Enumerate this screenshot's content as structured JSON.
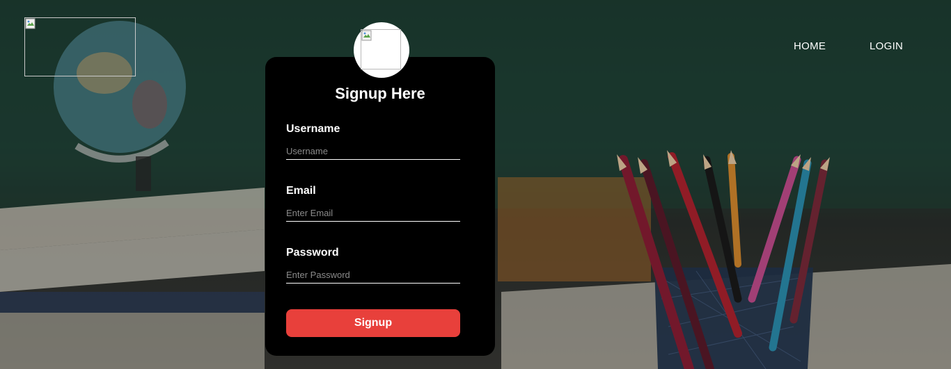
{
  "nav": {
    "home_label": "HOME",
    "login_label": "LOGIN"
  },
  "form": {
    "title": "Signup Here",
    "username": {
      "label": "Username",
      "placeholder": "Username",
      "value": ""
    },
    "email": {
      "label": "Email",
      "placeholder": "Enter Email",
      "value": ""
    },
    "password": {
      "label": "Password",
      "placeholder": "Enter Password",
      "value": ""
    },
    "submit_label": "Signup"
  },
  "colors": {
    "card_background": "#000000",
    "button_accent": "#e8403b",
    "text": "#ffffff"
  }
}
